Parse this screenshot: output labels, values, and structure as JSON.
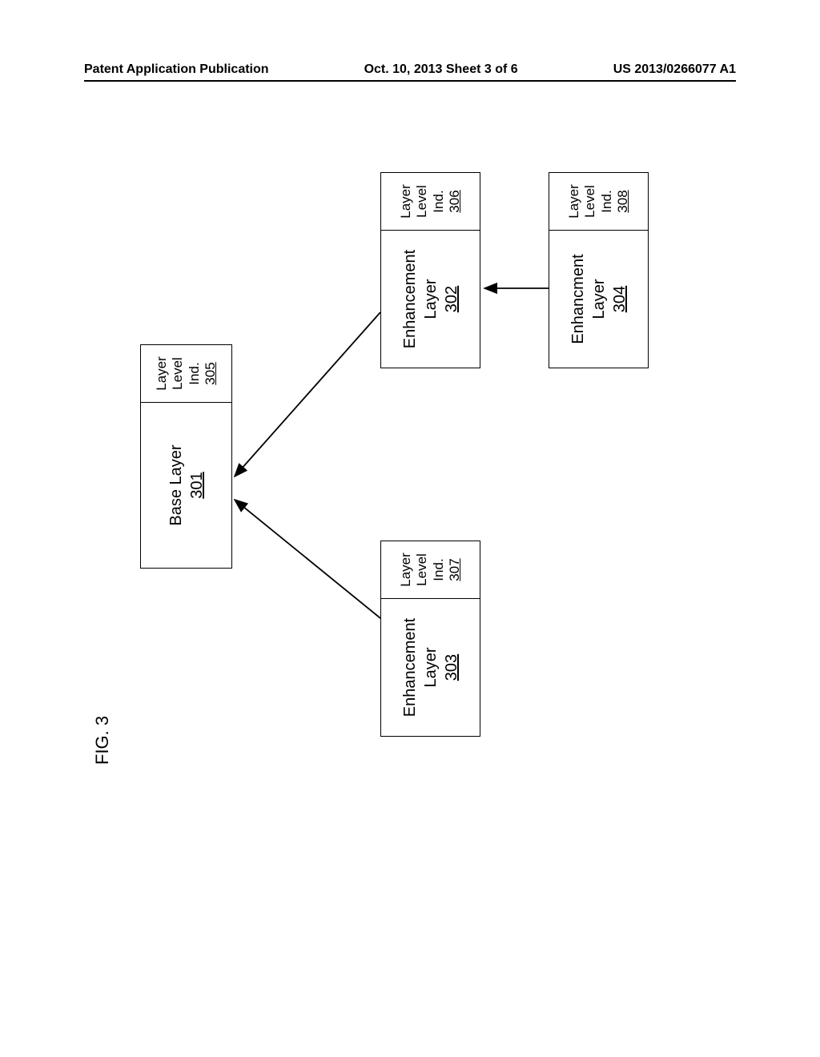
{
  "header": {
    "left": "Patent Application Publication",
    "center": "Oct. 10, 2013  Sheet 3 of 6",
    "right": "US 2013/0266077 A1"
  },
  "figure_label": "FIG. 3",
  "boxes": {
    "base": {
      "title": "Base Layer",
      "ref": "301",
      "ind_lines": [
        "Layer",
        "Level",
        "Ind."
      ],
      "ind_ref": "305"
    },
    "enh302": {
      "title_lines": [
        "Enhancement",
        "Layer"
      ],
      "ref": "302",
      "ind_lines": [
        "Layer",
        "Level",
        "Ind."
      ],
      "ind_ref": "306"
    },
    "enh303": {
      "title_lines": [
        "Enhancement",
        "Layer"
      ],
      "ref": "303",
      "ind_lines": [
        "Layer",
        "Level",
        "Ind."
      ],
      "ind_ref": "307"
    },
    "enh304": {
      "title_lines": [
        "Enhancment",
        "Layer"
      ],
      "ref": "304",
      "ind_lines": [
        "Layer",
        "Level",
        "Ind."
      ],
      "ind_ref": "308"
    }
  }
}
